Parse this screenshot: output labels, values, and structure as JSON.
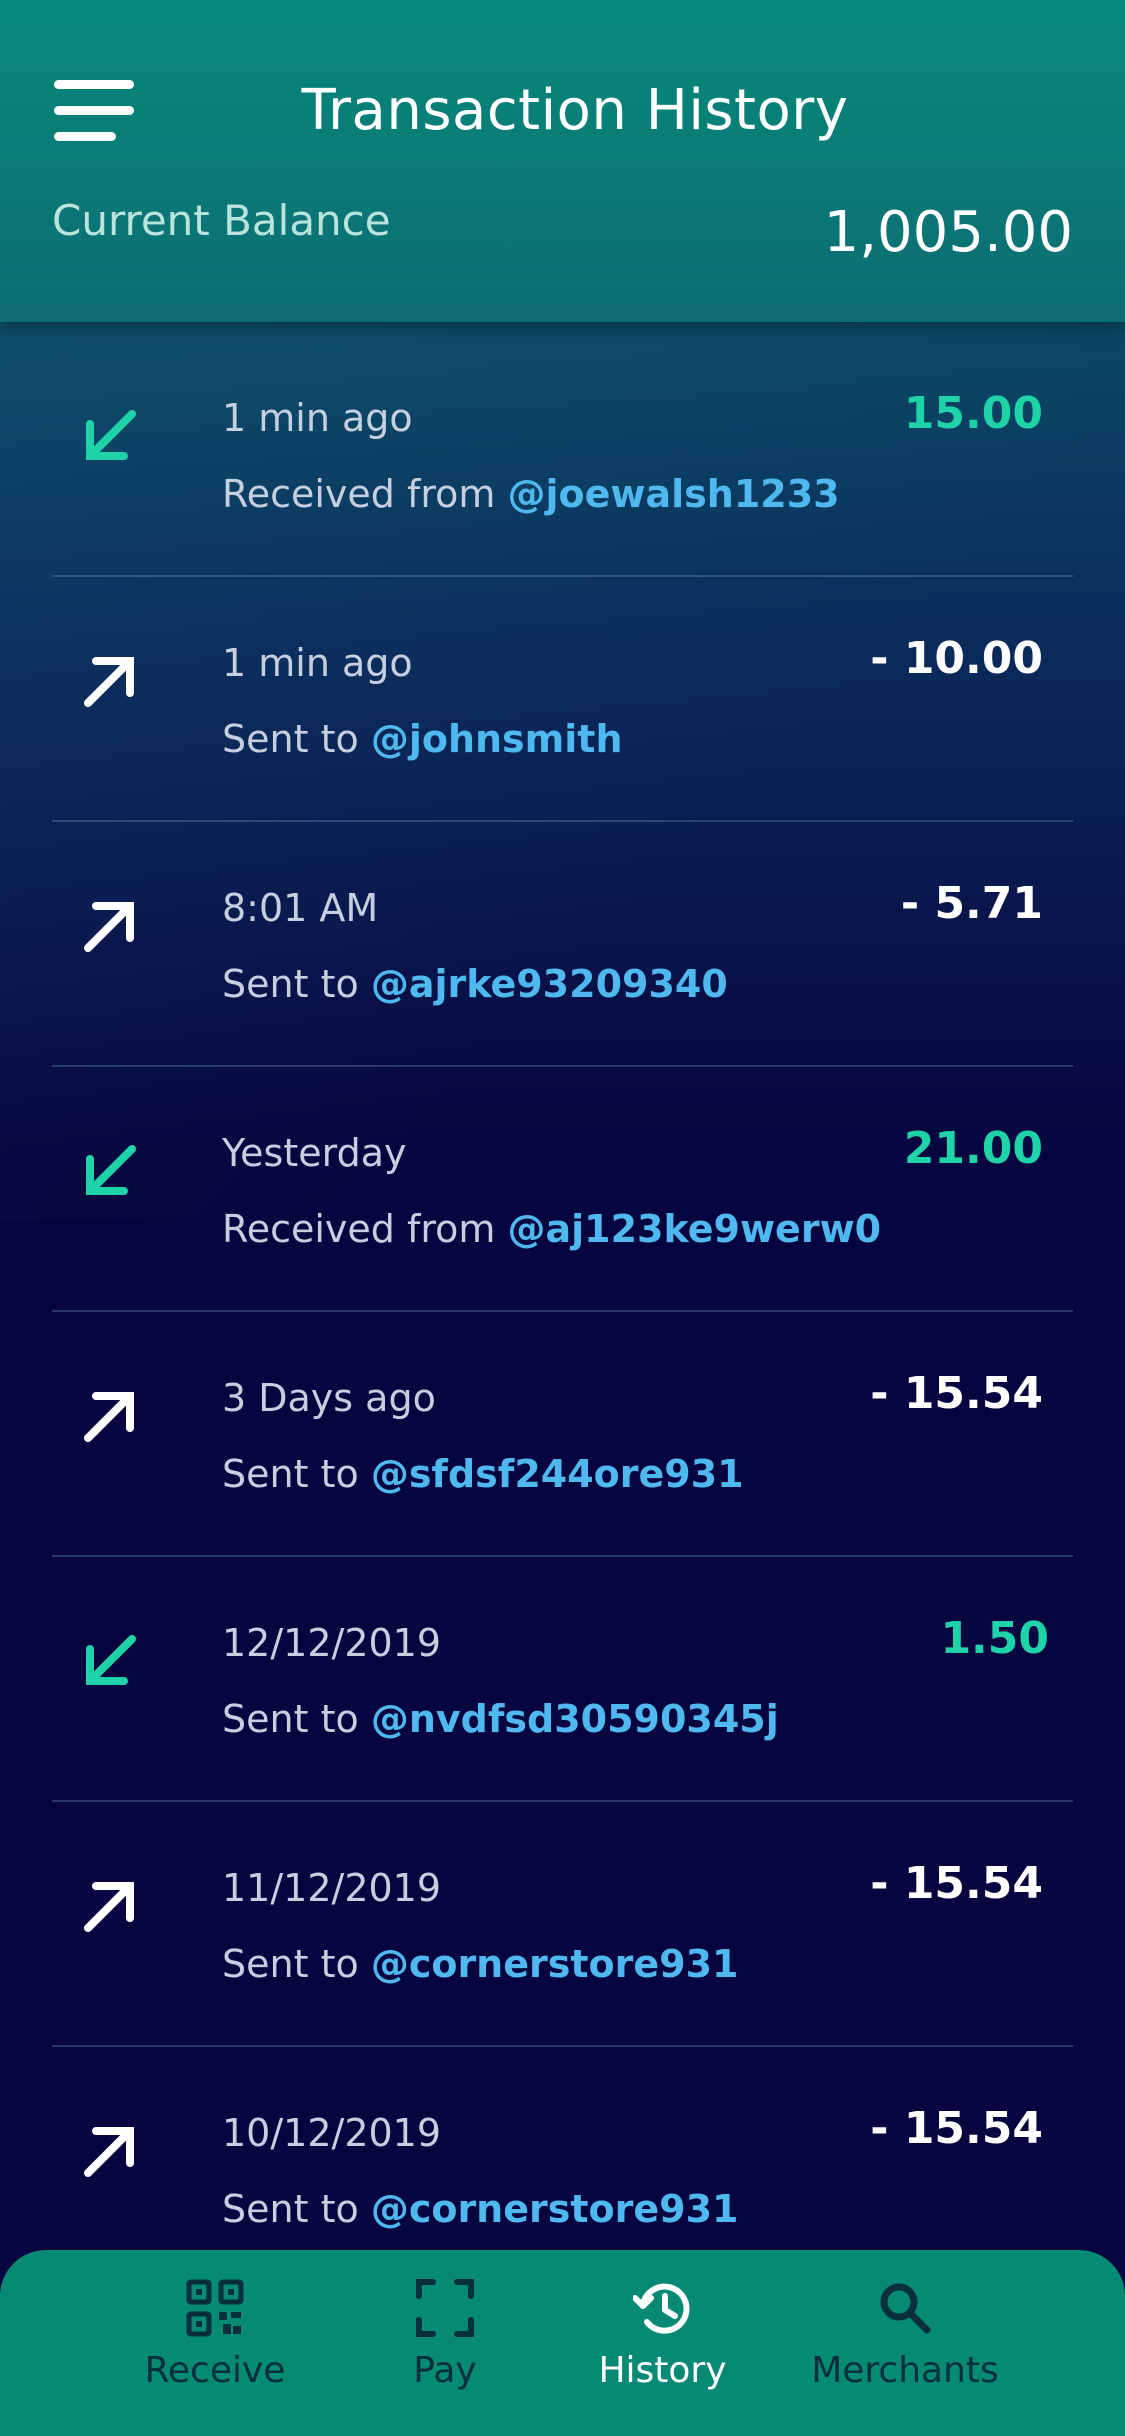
{
  "header": {
    "title": "Transaction History",
    "balance_label": "Current Balance",
    "balance_value": "1,005.00"
  },
  "transactions": [
    {
      "direction": "in",
      "icon": "arrow-down-left-icon",
      "when": "1 min ago",
      "prefix": "Received from",
      "handle": "@joewalsh1233",
      "amount": "15.00"
    },
    {
      "direction": "out",
      "icon": "arrow-up-right-icon",
      "when": "1 min ago",
      "prefix": "Sent to",
      "handle": "@johnsmith",
      "amount": "- 10.00"
    },
    {
      "direction": "out",
      "icon": "arrow-up-right-icon",
      "when": "8:01 AM",
      "prefix": "Sent to",
      "handle": "@ajrke93209340",
      "amount": "- 5.71"
    },
    {
      "direction": "in",
      "icon": "arrow-down-left-icon",
      "when": "Yesterday",
      "prefix": "Received from",
      "handle": "@aj123ke9werw0",
      "amount": "21.00"
    },
    {
      "direction": "out",
      "icon": "arrow-up-right-icon",
      "when": "3 Days ago",
      "prefix": "Sent to",
      "handle": "@sfdsf244ore931",
      "amount": "- 15.54"
    },
    {
      "direction": "in",
      "icon": "arrow-down-left-icon",
      "when": "12/12/2019",
      "prefix": "Sent to",
      "handle": "@nvdfsd30590345j",
      "amount": "1.50"
    },
    {
      "direction": "out",
      "icon": "arrow-up-right-icon",
      "when": "11/12/2019",
      "prefix": "Sent to",
      "handle": "@cornerstore931",
      "amount": "- 15.54"
    },
    {
      "direction": "out",
      "icon": "arrow-up-right-icon",
      "when": "10/12/2019",
      "prefix": "Sent to",
      "handle": "@cornerstore931",
      "amount": "- 15.54"
    }
  ],
  "tabbar": {
    "active": "History",
    "tabs": [
      {
        "label": "Receive",
        "icon": "qr-code-icon"
      },
      {
        "label": "Pay",
        "icon": "scan-frame-icon"
      },
      {
        "label": "History",
        "icon": "history-clock-icon"
      },
      {
        "label": "Merchants",
        "icon": "search-icon"
      }
    ]
  },
  "colors": {
    "header_teal": "#068a7a",
    "background_navy": "#07053f",
    "incoming_green": "#1fd3a9",
    "handle_blue": "#4fb8ee",
    "tabbar_green": "#068a73"
  }
}
